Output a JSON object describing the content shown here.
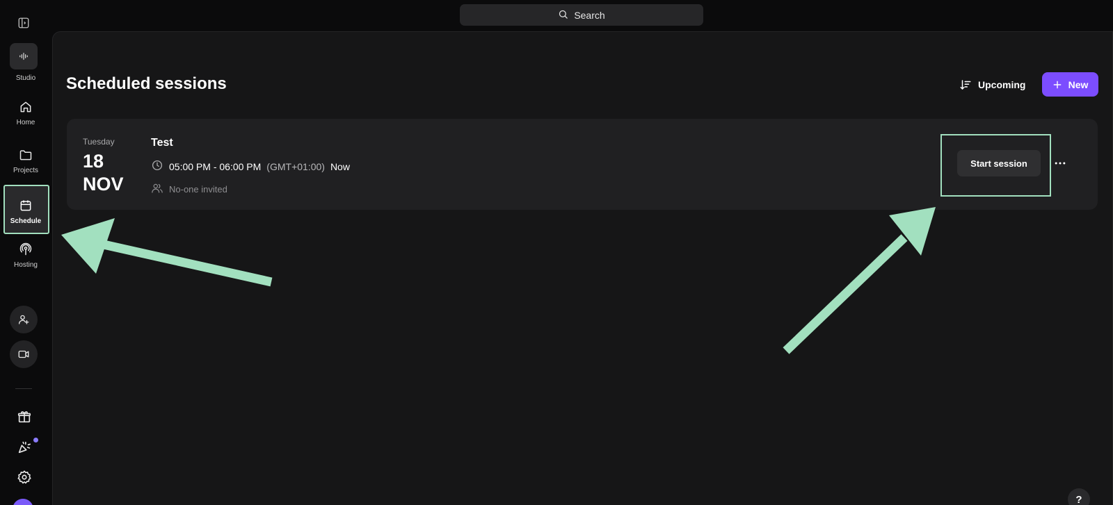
{
  "search": {
    "label": "Search"
  },
  "sidebar": {
    "studio_label": "Studio",
    "items": [
      {
        "label": "Home",
        "icon": "home-icon"
      },
      {
        "label": "Projects",
        "icon": "folder-icon"
      },
      {
        "label": "Schedule",
        "icon": "calendar-icon",
        "active": true
      },
      {
        "label": "Hosting",
        "icon": "podcast-icon"
      }
    ]
  },
  "header": {
    "title": "Scheduled sessions",
    "sort_label": "Upcoming",
    "new_label": "New"
  },
  "session": {
    "day": "Tuesday",
    "date_day": "18",
    "date_month": "NOV",
    "title": "Test",
    "time": "05:00 PM - 06:00 PM",
    "timezone": "(GMT+01:00)",
    "status": "Now",
    "invitees": "No-one invited",
    "start_label": "Start session"
  },
  "help": {
    "label": "?"
  },
  "colors": {
    "accent": "#7c4dff",
    "annotation": "#a2e0bf",
    "background": "#0b0b0c",
    "panel": "#161617",
    "card": "#202022"
  }
}
